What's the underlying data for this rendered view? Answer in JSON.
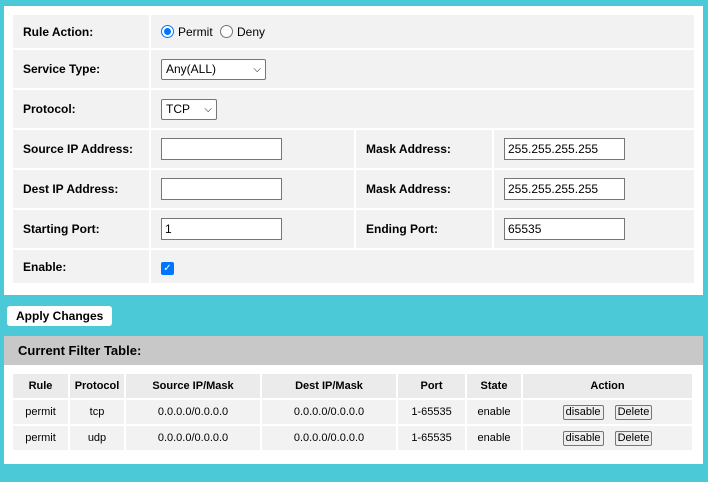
{
  "form": {
    "rule_action": {
      "label": "Rule Action:",
      "options": [
        "Permit",
        "Deny"
      ],
      "selected": "Permit"
    },
    "service_type": {
      "label": "Service Type:",
      "value": "Any(ALL)"
    },
    "protocol": {
      "label": "Protocol:",
      "value": "TCP"
    },
    "source_ip": {
      "label": "Source IP Address:",
      "value": "",
      "mask_label": "Mask Address:",
      "mask_value": "255.255.255.255"
    },
    "dest_ip": {
      "label": "Dest IP Address:",
      "value": "",
      "mask_label": "Mask Address:",
      "mask_value": "255.255.255.255"
    },
    "ports": {
      "start_label": "Starting Port:",
      "start_value": "1",
      "end_label": "Ending Port:",
      "end_value": "65535"
    },
    "enable": {
      "label": "Enable:",
      "checked": true
    }
  },
  "apply_label": "Apply Changes",
  "filter_table": {
    "title": "Current Filter Table:",
    "columns": [
      "Rule",
      "Protocol",
      "Source IP/Mask",
      "Dest IP/Mask",
      "Port",
      "State",
      "Action"
    ],
    "rows": [
      {
        "rule": "permit",
        "protocol": "tcp",
        "source": "0.0.0.0/0.0.0.0",
        "dest": "0.0.0.0/0.0.0.0",
        "port": "1-65535",
        "state": "enable",
        "btn1": "disable",
        "btn2": "Delete"
      },
      {
        "rule": "permit",
        "protocol": "udp",
        "source": "0.0.0.0/0.0.0.0",
        "dest": "0.0.0.0/0.0.0.0",
        "port": "1-65535",
        "state": "enable",
        "btn1": "disable",
        "btn2": "Delete"
      }
    ]
  },
  "colors": {
    "background": "#4cc9d6",
    "accent": "#0075ff",
    "header_bar": "#c8c8c8"
  }
}
